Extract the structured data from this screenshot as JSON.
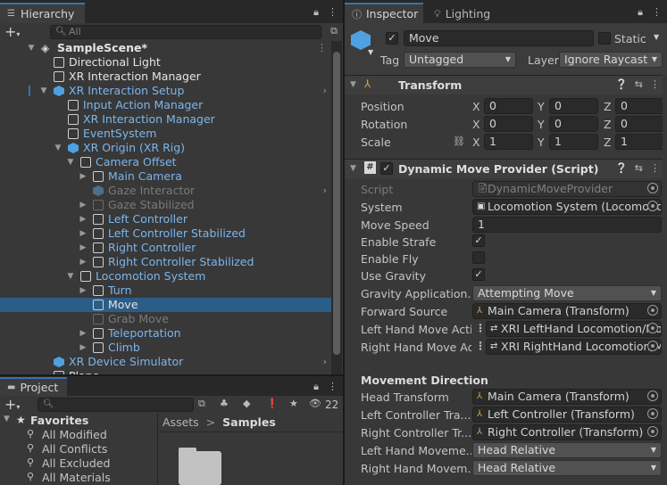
{
  "hierarchy": {
    "tab_label": "Hierarchy",
    "search_placeholder": "All",
    "scene_name": "SampleScene*",
    "items": [
      {
        "label": "Directional Light"
      },
      {
        "label": "XR Interaction Manager"
      },
      {
        "label": "XR Interaction Setup"
      },
      {
        "label": "Input Action Manager"
      },
      {
        "label": "XR Interaction Manager"
      },
      {
        "label": "EventSystem"
      },
      {
        "label": "XR Origin (XR Rig)"
      },
      {
        "label": "Camera Offset"
      },
      {
        "label": "Main Camera"
      },
      {
        "label": "Gaze Interactor"
      },
      {
        "label": "Gaze Stabilized"
      },
      {
        "label": "Left Controller"
      },
      {
        "label": "Left Controller Stabilized"
      },
      {
        "label": "Right Controller"
      },
      {
        "label": "Right Controller Stabilized"
      },
      {
        "label": "Locomotion System"
      },
      {
        "label": "Turn"
      },
      {
        "label": "Move"
      },
      {
        "label": "Grab Move"
      },
      {
        "label": "Teleportation"
      },
      {
        "label": "Climb"
      },
      {
        "label": "XR Device Simulator"
      },
      {
        "label": "Plane"
      }
    ]
  },
  "project": {
    "tab_label": "Project",
    "badge_count": "22",
    "favorites_label": "Favorites",
    "favorites": [
      "All Modified",
      "All Conflicts",
      "All Excluded",
      "All Materials"
    ],
    "breadcrumb": {
      "root": "Assets",
      "current": "Samples"
    }
  },
  "inspector": {
    "tab_label": "Inspector",
    "lighting_tab_label": "Lighting",
    "object_name": "Move",
    "static_label": "Static",
    "tag_label": "Tag",
    "tag_value": "Untagged",
    "layer_label": "Layer",
    "layer_value": "Ignore Raycast",
    "transform": {
      "title": "Transform",
      "position_label": "Position",
      "rotation_label": "Rotation",
      "scale_label": "Scale",
      "axis_x": "X",
      "axis_y": "Y",
      "axis_z": "Z",
      "position": [
        "0",
        "0",
        "0"
      ],
      "rotation": [
        "0",
        "0",
        "0"
      ],
      "scale": [
        "1",
        "1",
        "1"
      ]
    },
    "provider": {
      "title": "Dynamic Move Provider (Script)",
      "script_label": "Script",
      "script_value": "DynamicMoveProvider",
      "system_label": "System",
      "system_value": "Locomotion System (Locomotion",
      "move_speed_label": "Move Speed",
      "move_speed_value": "1",
      "enable_strafe_label": "Enable Strafe",
      "enable_strafe": true,
      "enable_fly_label": "Enable Fly",
      "enable_fly": false,
      "use_gravity_label": "Use Gravity",
      "use_gravity": true,
      "gravity_app_label": "Gravity Application...",
      "gravity_app_value": "Attempting Move",
      "forward_source_label": "Forward Source",
      "forward_source_value": "Main Camera (Transform)",
      "left_move_action_label": "Left Hand Move Actio",
      "left_move_action_value": "XRI LeftHand Locomotion/Mo",
      "right_move_action_label": "Right Hand Move Acti",
      "right_move_action_value": "XRI RightHand Locomotion/M",
      "movement_direction_label": "Movement Direction",
      "head_transform_label": "Head Transform",
      "head_transform_value": "Main Camera (Transform)",
      "left_ctrl_label": "Left Controller Tra...",
      "left_ctrl_value": "Left Controller (Transform)",
      "right_ctrl_label": "Right Controller Tr...",
      "right_ctrl_value": "Right Controller (Transform)",
      "left_mode_label": "Left Hand Moveme...",
      "left_mode_value": "Head Relative",
      "right_mode_label": "Right Hand Movem...",
      "right_mode_value": "Head Relative"
    }
  },
  "colors": {
    "selection": "#2c5d87",
    "prefab_blue": "#7cb5ec",
    "tab_accent": "#3a72b0"
  }
}
